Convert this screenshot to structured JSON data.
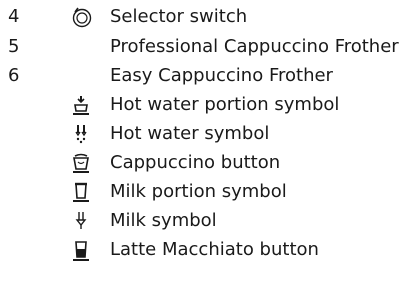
{
  "items": [
    {
      "number": "4",
      "label": "Selector switch",
      "icon": "selector-switch-icon"
    },
    {
      "number": "5",
      "label": "Professional Cappuccino Frother"
    },
    {
      "number": "6",
      "label": "Easy Cappuccino Frother"
    }
  ],
  "symbols": [
    {
      "label": "Hot water portion symbol",
      "icon": "hot-water-portion-icon"
    },
    {
      "label": "Hot water symbol",
      "icon": "hot-water-icon"
    },
    {
      "label": "Cappuccino button",
      "icon": "cappuccino-icon"
    },
    {
      "label": "Milk portion symbol",
      "icon": "milk-portion-icon"
    },
    {
      "label": "Milk symbol",
      "icon": "milk-icon"
    },
    {
      "label": "Latte Macchiato button",
      "icon": "latte-macchiato-icon"
    }
  ]
}
